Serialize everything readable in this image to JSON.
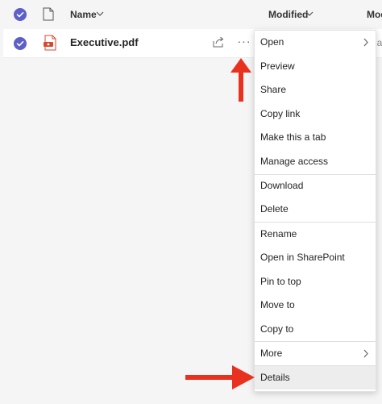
{
  "header": {
    "name_label": "Name",
    "modified_label": "Modified",
    "modified_by_label": "Mod"
  },
  "file": {
    "name": "Executive.pdf",
    "more_label": "···",
    "partial_cell": "lat"
  },
  "menu": {
    "items": [
      {
        "label": "Open",
        "submenu": true
      },
      {
        "label": "Preview"
      },
      {
        "label": "Share"
      },
      {
        "label": "Copy link"
      },
      {
        "label": "Make this a tab"
      },
      {
        "label": "Manage access"
      },
      {
        "label": "Download"
      },
      {
        "label": "Delete"
      },
      {
        "label": "Rename"
      },
      {
        "label": "Open in SharePoint"
      },
      {
        "label": "Pin to top"
      },
      {
        "label": "Move to"
      },
      {
        "label": "Copy to"
      },
      {
        "label": "More",
        "submenu": true
      },
      {
        "label": "Details",
        "highlighted": true
      }
    ]
  },
  "colors": {
    "accent": "#5b5fc7",
    "annotation_arrow": "#e8321f",
    "pdf_icon": "#d9472f"
  }
}
